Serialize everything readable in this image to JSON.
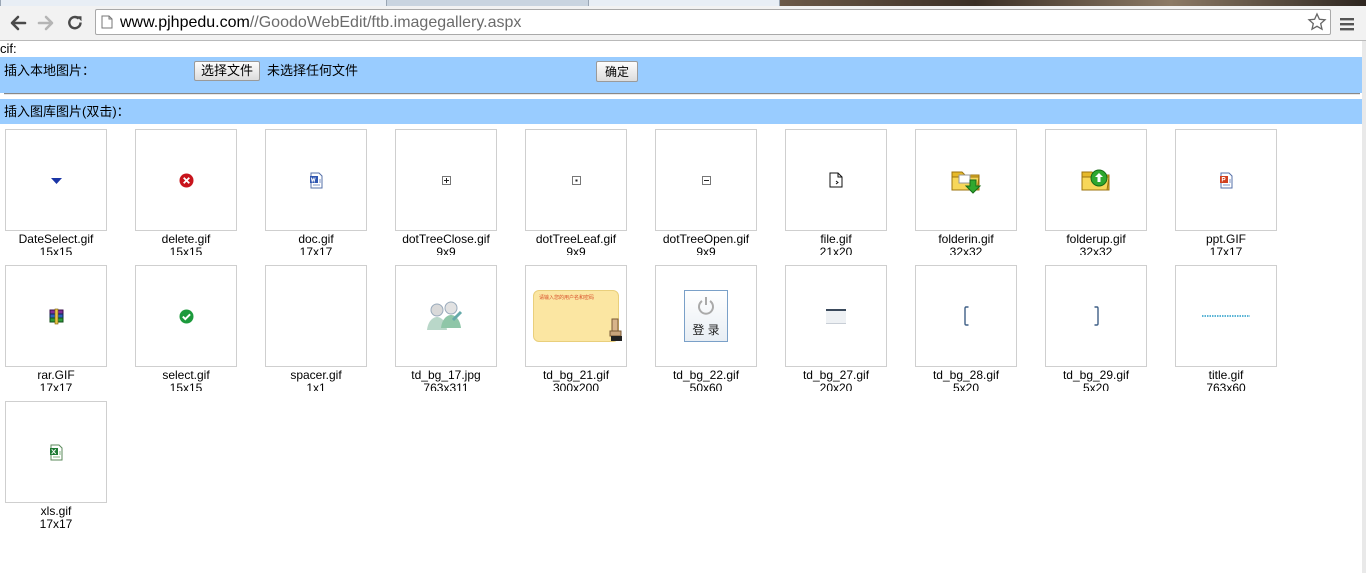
{
  "browser": {
    "url_host": "www.pjhpedu.com",
    "url_path": "//GoodoWebEdit/ftb.imagegallery.aspx"
  },
  "page": {
    "label": "cif:",
    "insert_local_label": "插入本地图片：",
    "choose_file_button": "选择文件",
    "file_status": "未选择任何文件",
    "confirm_button": "确定",
    "gallery_label": "插入图库图片(双击)："
  },
  "gallery": {
    "rows": [
      [
        {
          "name": "DateSelect.gif",
          "size": "15x15",
          "icon": "dropdown-arrow-icon"
        },
        {
          "name": "delete.gif",
          "size": "15x15",
          "icon": "delete-icon"
        },
        {
          "name": "doc.gif",
          "size": "17x17",
          "icon": "word-doc-icon"
        },
        {
          "name": "dotTreeClose.gif",
          "size": "9x9",
          "icon": "tree-plus-icon"
        },
        {
          "name": "dotTreeLeaf.gif",
          "size": "9x9",
          "icon": "tree-leaf-icon"
        },
        {
          "name": "dotTreeOpen.gif",
          "size": "9x9",
          "icon": "tree-minus-icon"
        },
        {
          "name": "file.gif",
          "size": "21x20",
          "icon": "file-icon"
        },
        {
          "name": "folderin.gif",
          "size": "32x32",
          "icon": "folder-in-icon"
        },
        {
          "name": "folderup.gif",
          "size": "32x32",
          "icon": "folder-up-icon"
        },
        {
          "name": "ppt.GIF",
          "size": "17x17",
          "icon": "powerpoint-icon"
        }
      ],
      [
        {
          "name": "rar.GIF",
          "size": "17x17",
          "icon": "rar-archive-icon"
        },
        {
          "name": "select.gif",
          "size": "15x15",
          "icon": "checkmark-icon"
        },
        {
          "name": "spacer.gif",
          "size": "1x1",
          "icon": "blank-spacer"
        },
        {
          "name": "td_bg_17.jpg",
          "size": "763x311",
          "icon": "users-image"
        },
        {
          "name": "td_bg_21.gif",
          "size": "300x200",
          "icon": "login-note-image"
        },
        {
          "name": "td_bg_22.gif",
          "size": "50x60",
          "icon": "power-login-image"
        },
        {
          "name": "td_bg_27.gif",
          "size": "20x20",
          "icon": "bar-image"
        },
        {
          "name": "td_bg_28.gif",
          "size": "5x20",
          "icon": "left-bracket-image"
        },
        {
          "name": "td_bg_29.gif",
          "size": "5x20",
          "icon": "right-bracket-image"
        },
        {
          "name": "title.gif",
          "size": "763x60",
          "icon": "title-strip-image"
        }
      ],
      [
        {
          "name": "xls.gif",
          "size": "17x17",
          "icon": "excel-icon"
        }
      ]
    ],
    "thumb_texts": {
      "login_note": "请输入您的用户名和密码",
      "login_button": "登 录"
    }
  },
  "colors": {
    "band": "#99ccff",
    "thumb_border": "#cfcfcf"
  }
}
